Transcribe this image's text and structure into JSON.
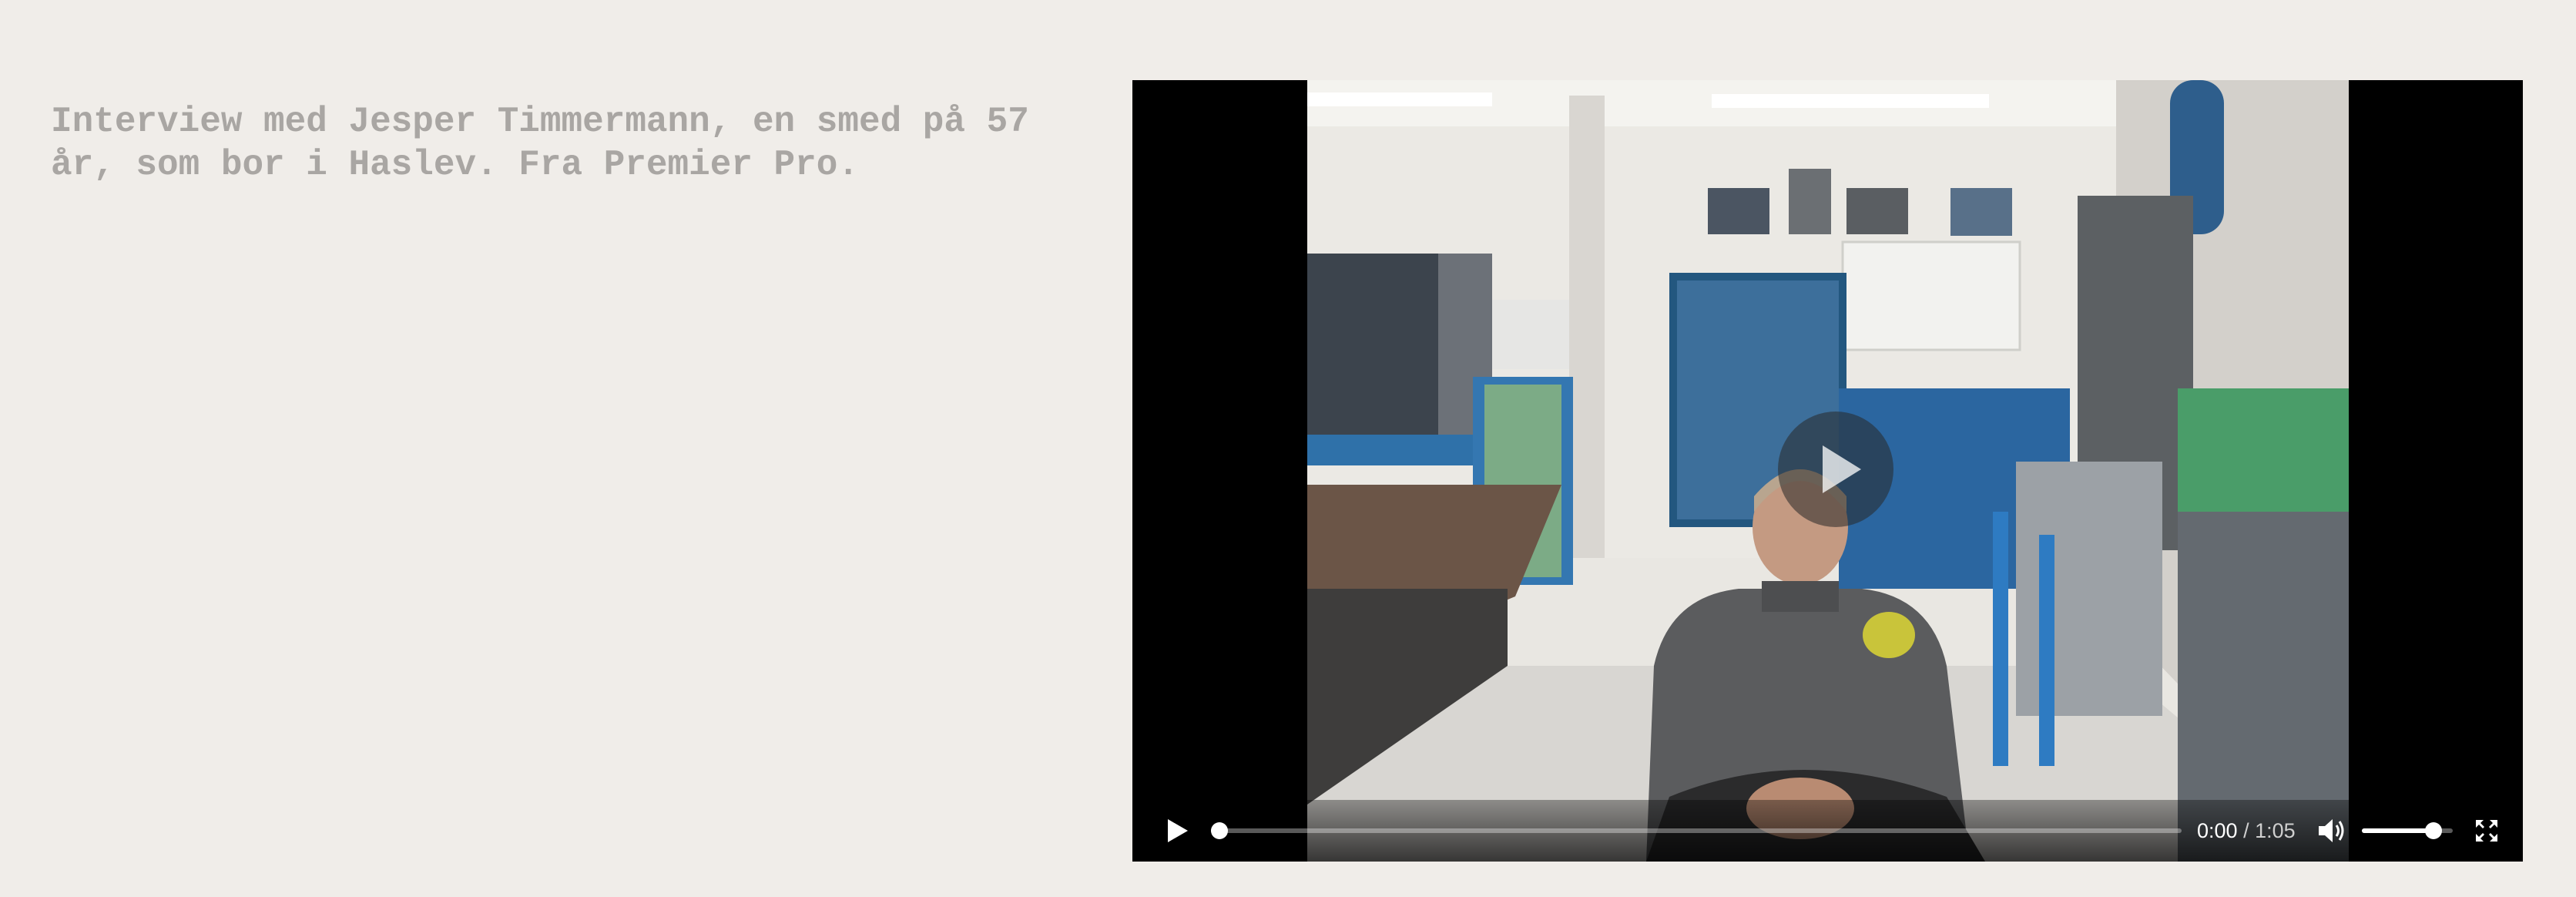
{
  "caption": {
    "text": "Interview med Jesper Timmermann, en smed på 57\når, som bor i Haslev. Fra Premier Pro."
  },
  "video": {
    "current_time": "0:00",
    "separator": " / ",
    "duration": "1:05",
    "progress": 0.0,
    "volume": 0.85,
    "playing": false,
    "icons": {
      "big_play": "play-overlay-icon",
      "play": "play-icon",
      "volume": "volume-icon",
      "fullscreen": "fullscreen-icon"
    },
    "colors": {
      "letterbox": "#000000",
      "control_fill": "#ffffff"
    }
  }
}
